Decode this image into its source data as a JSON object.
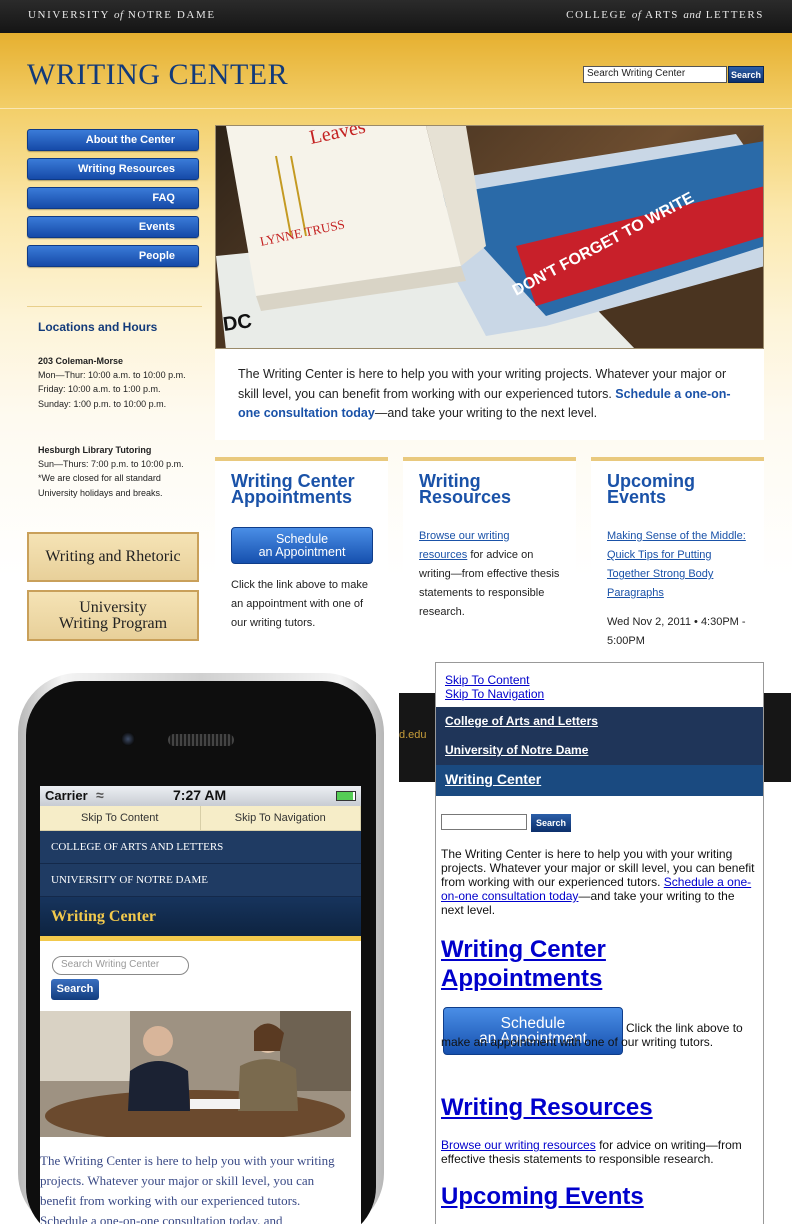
{
  "topbar": {
    "university_1": "UNIVERSITY",
    "university_of": "of",
    "university_2": "NOTRE DAME",
    "college_1": "COLLEGE",
    "college_of": "of",
    "college_2": "ARTS",
    "college_and": "and",
    "college_3": "LETTERS"
  },
  "header": {
    "site_title": "WRITING CENTER",
    "search_value": "Search Writing Center",
    "search_button": "Search"
  },
  "nav": [
    "About the Center",
    "Writing Resources",
    "FAQ",
    "Events",
    "People"
  ],
  "hours": {
    "title": "Locations and Hours",
    "loc1": {
      "name": "203 Coleman-Morse",
      "lines": [
        "Mon—Thur: 10:00 a.m. to 10:00 p.m.",
        "Friday: 10:00 a.m. to 1:00 p.m.",
        "Sunday: 1:00 p.m. to 10:00 p.m."
      ]
    },
    "loc2": {
      "name": "Hesburgh Library Tutoring",
      "lines": [
        "Sun—Thurs: 7:00 p.m. to 10:00 p.m.",
        "*We are closed for all standard",
        "University holidays and breaks."
      ]
    }
  },
  "sideboxes": [
    "Writing and Rhetoric",
    "University",
    "Writing Program"
  ],
  "hero": {
    "book_top": "Leaves",
    "author": "LYNNE TRUSS",
    "book_side": "DON'T FORGET TO WRITE",
    "spine_letters": "DC"
  },
  "intro": {
    "text": "The Writing Center is here to help you with your writing projects. Whatever your major or skill level, you can benefit from working with our experienced tutors. ",
    "link": "Schedule a one-on-one consultation today",
    "tail": "—and take your writing to the next level."
  },
  "columns": {
    "appointments": {
      "title": "Writing Center Appointments",
      "button_1": "Schedule",
      "button_2": "an Appointment",
      "text": "Click the link above to make an appointment with one of our writing tutors."
    },
    "resources": {
      "title": "Writing Resources",
      "link": "Browse our writing resources",
      "text": " for advice on writing—from effective thesis statements to responsible research."
    },
    "events": {
      "title": "Upcoming Events",
      "link": "Making Sense of the Middle: Quick Tips for Putting Together Strong Body Paragraphs",
      "date": "Wed Nov 2, 2011 • 4:30PM - 5:00PM"
    }
  },
  "mobile": {
    "carrier": "Carrier",
    "time": "7:27 AM",
    "skip_content": "Skip To Content",
    "skip_nav": "Skip To Navigation",
    "nav_1": "COLLEGE OF ARTS AND LETTERS",
    "nav_2": "UNIVERSITY OF NOTRE DAME",
    "title": "Writing Center",
    "search_placeholder": "Search Writing Center",
    "search_button": "Search",
    "text": "The Writing Center is here to help you with your writing projects. Whatever your major or skill level, you can benefit from working with our experienced tutors. Schedule a one-on-one consultation today, and"
  },
  "unstyled": {
    "bg_fragment": "d.edu",
    "skip_content": "Skip To Content",
    "skip_nav": "Skip To Navigation",
    "nav_1": "College of Arts and Letters",
    "nav_2": "University of Notre Dame",
    "nav_current": "Writing Center",
    "search_button": "Search",
    "intro": "The Writing Center is here to help you with your writing projects. Whatever your major or skill level, you can benefit from working with our experienced tutors. ",
    "intro_link": "Schedule a one-on-one consultation today",
    "intro_tail": "—and take your writing to the next level.",
    "h_appointments": "Writing Center Appointments",
    "button_1": "Schedule",
    "button_2": "an Appointment",
    "appointments_text": "Click the link above to make an appointment with one of our writing tutors.",
    "h_resources": "Writing Resources",
    "resources_link": "Browse our writing resources",
    "resources_text": " for advice on writing—from effective thesis statements to responsible research.",
    "h_events": "Upcoming Events"
  },
  "colors": {
    "navy": "#123a7a",
    "link_blue": "#1a52a8",
    "gold": "#f2c94c",
    "mobile_nav": "#1f3b63"
  }
}
